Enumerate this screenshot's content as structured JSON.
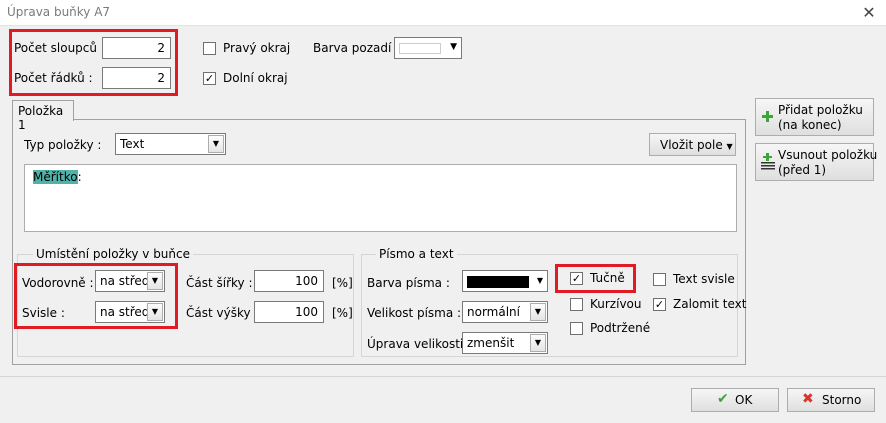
{
  "window": {
    "title": "Úprava buňky A7",
    "close_glyph": "✕"
  },
  "top": {
    "columns_label": "Počet sloupců :",
    "columns_value": "2",
    "rows_label": "Počet řádků :",
    "rows_value": "2",
    "right_border_label": "Pravý okraj",
    "right_border_checked": false,
    "bottom_border_label": "Dolní okraj",
    "bottom_border_checked": true,
    "background_label": "Barva pozadí :",
    "background_color": "#ffffff"
  },
  "tab": {
    "label": "Položka 1"
  },
  "item": {
    "type_label": "Typ položky :",
    "type_value": "Text",
    "insert_field_label": "Vložit pole",
    "text_highlight": "Měřítko",
    "text_rest": ":"
  },
  "placement": {
    "group_title": "Umístění položky v buňce",
    "horizontal_label": "Vodorovně :",
    "horizontal_value": "na střed",
    "vertical_label": "Svisle :",
    "vertical_value": "na střed",
    "width_part_label": "Část šířky :",
    "width_part_value": "100",
    "height_part_label": "Část výšky :",
    "height_part_value": "100",
    "unit": "[%]"
  },
  "font": {
    "group_title": "Písmo a text",
    "color_label": "Barva písma :",
    "color_value": "#000000",
    "size_label": "Velikost písma :",
    "size_value": "normální",
    "scale_label": "Úprava velikosti :",
    "scale_value": "zmenšit",
    "bold_label": "Tučně",
    "bold_checked": true,
    "italic_label": "Kurzívou",
    "italic_checked": false,
    "underline_label": "Podtržené",
    "underline_checked": false,
    "vertical_text_label": "Text svisle",
    "vertical_text_checked": false,
    "wrap_text_label": "Zalomit text",
    "wrap_text_checked": true
  },
  "side": {
    "add_item_line1": "Přidat položku",
    "add_item_line2": "(na konec)",
    "insert_item_line1": "Vsunout položku",
    "insert_item_line2": "(před 1)"
  },
  "footer": {
    "ok_label": "OK",
    "cancel_label": "Storno"
  },
  "colors": {
    "accent_red": "#e01b24",
    "highlight": "#4fb3a9",
    "ok_green": "#3aa63a",
    "cancel_red": "#d9342b"
  }
}
